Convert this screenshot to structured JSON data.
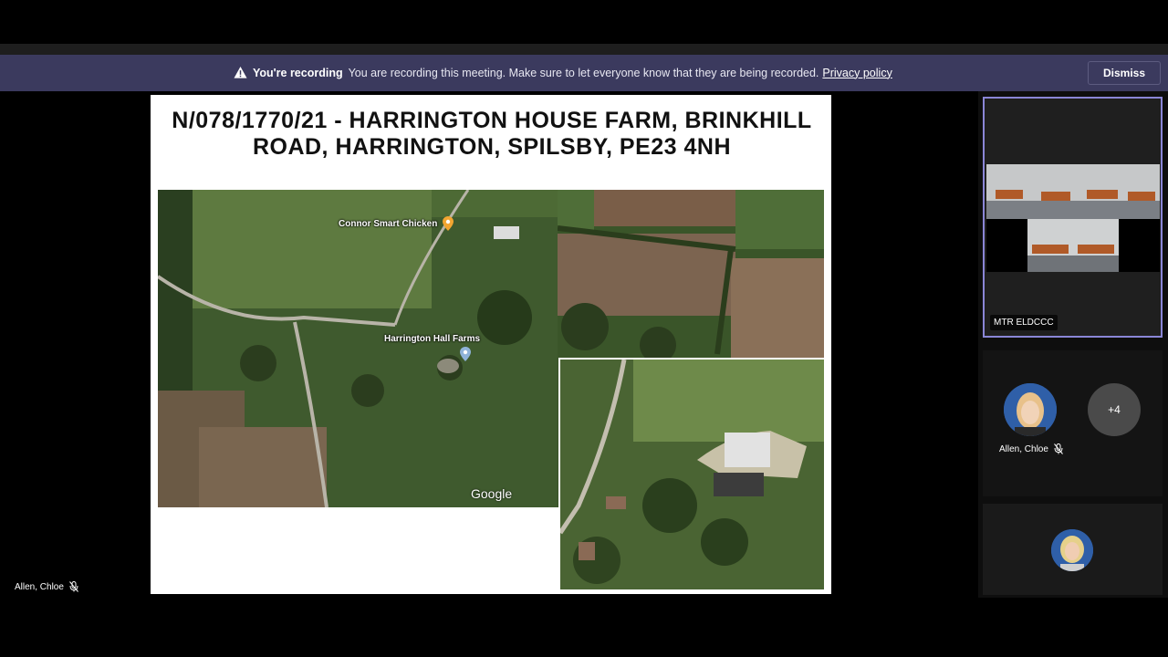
{
  "banner": {
    "title": "You're recording",
    "message": "You are recording this meeting. Make sure to let everyone know that they are being recorded.",
    "link": "Privacy policy",
    "dismiss_label": "Dismiss",
    "icon": "warning-icon"
  },
  "slide": {
    "title": "N/078/1770/21 - HARRINGTON HOUSE FARM, BRINKHILL ROAD, HARRINGTON, SPILSBY, PE23 4NH",
    "map_labels": {
      "poi_1": "Connor Smart Chicken",
      "poi_2": "Harrington Hall Farms",
      "google": "Google"
    }
  },
  "speaker": {
    "name": "Allen, Chloe",
    "icon": "mic-off-icon"
  },
  "sidebar": {
    "room_tile_label": "MTR ELDCCC",
    "participant_name": "Allen, Chloe",
    "more_count": "+4"
  },
  "colors": {
    "banner_bg": "#3b3a5e",
    "active_tile_border": "#8a86d6"
  }
}
